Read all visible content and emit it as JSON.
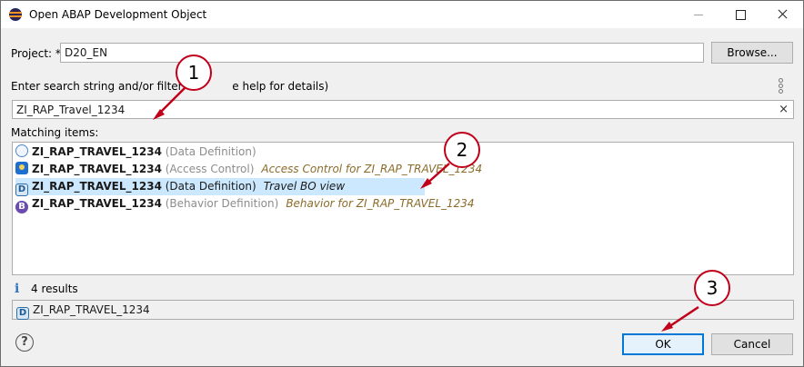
{
  "window": {
    "title": "Open ABAP Development Object"
  },
  "project": {
    "label": "Project: *",
    "value": "D20_EN",
    "browse_label": "Browse..."
  },
  "search": {
    "label": "Enter search string and/or filter cri",
    "label_tail": "e help for details)",
    "value": "ZI_RAP_Travel_1234"
  },
  "matching": {
    "label": "Matching items:"
  },
  "items": [
    {
      "name": "ZI_RAP_TRAVEL_1234",
      "type": " (Data Definition)",
      "desc": ""
    },
    {
      "name": "ZI_RAP_TRAVEL_1234",
      "type": " (Access Control)",
      "desc": "Access Control for ZI_RAP_TRAVEL_1234"
    },
    {
      "name": "ZI_RAP_TRAVEL_1234",
      "type": " (Data Definition)",
      "desc": "Travel BO view"
    },
    {
      "name": "ZI_RAP_TRAVEL_1234",
      "type": " (Behavior Definition)",
      "desc": "Behavior for ZI_RAP_TRAVEL_1234"
    }
  ],
  "results": {
    "text": "4 results",
    "selected": "ZI_RAP_TRAVEL_1234"
  },
  "buttons": {
    "ok": "OK",
    "cancel": "Cancel"
  },
  "callouts": [
    "1",
    "2",
    "3"
  ],
  "icons": {
    "dd_icon_letter": "D",
    "bd_icon_letter": "B",
    "help": "?",
    "info": "i",
    "clear": "×"
  }
}
